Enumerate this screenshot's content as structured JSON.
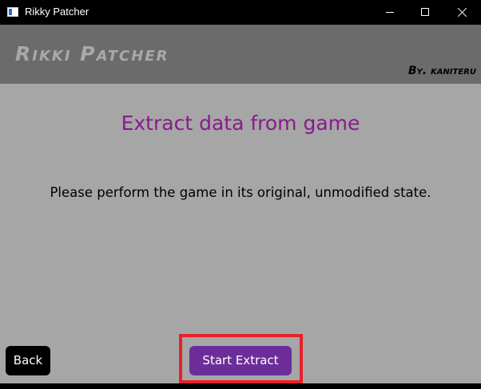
{
  "window": {
    "title": "Rikky Patcher"
  },
  "header": {
    "brand": "Rikki Patcher",
    "author": "By. kaniteru"
  },
  "main": {
    "title": "Extract data from game",
    "instruction": "Please perform the game in its original, unmodified state."
  },
  "buttons": {
    "back_label": "Back",
    "start_label": "Start Extract"
  },
  "colors": {
    "title_purple": "#8a1a8f",
    "start_button": "#6c2d9a",
    "highlight": "#e8202a",
    "background": "#a6a6a6",
    "header": "#6b6b6b"
  }
}
